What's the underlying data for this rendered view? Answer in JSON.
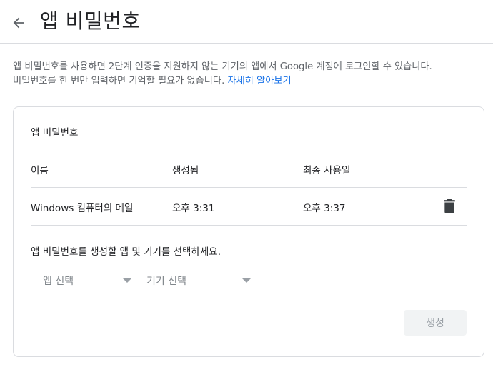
{
  "header": {
    "title": "앱 비밀번호",
    "back_icon": "arrow-back-icon"
  },
  "intro": {
    "line1": "앱 비밀번호를 사용하면 2단계 인증을 지원하지 않는 기기의 앱에서 Google 계정에 로그인할 수 있습니다.",
    "line2": "비밀번호를 한 번만 입력하면 기억할 필요가 없습니다.",
    "learn_more": "자세히 알아보기"
  },
  "card": {
    "title": "앱 비밀번호",
    "columns": {
      "name": "이름",
      "created": "생성됨",
      "last_used": "최종 사용일"
    },
    "rows": [
      {
        "name": "Windows 컴퓨터의 메일",
        "created": "오후 3:31",
        "last_used": "오후 3:37",
        "delete_icon": "trash-icon"
      }
    ],
    "generate": {
      "label": "앱 비밀번호를 생성할 앱 및 기기를 선택하세요.",
      "app_select": "앱 선택",
      "device_select": "기기 선택",
      "button": "생성",
      "button_enabled": false
    }
  },
  "colors": {
    "link": "#1a73e8",
    "text": "#202124",
    "secondary_text": "#5f6368",
    "divider": "#dadce0",
    "disabled_button_bg": "#f1f3f4",
    "disabled_button_text": "#9aa0a6"
  }
}
